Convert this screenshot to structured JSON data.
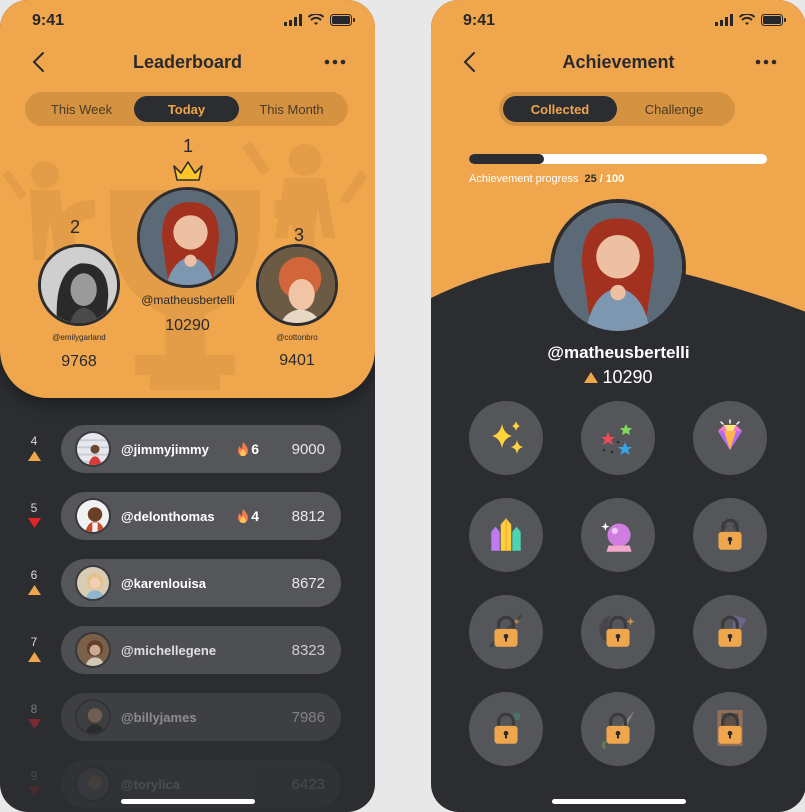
{
  "status": {
    "time": "9:41"
  },
  "leaderboard": {
    "title": "Leaderboard",
    "tabs": [
      {
        "label": "This Week",
        "active": false
      },
      {
        "label": "Today",
        "active": true
      },
      {
        "label": "This Month",
        "active": false
      }
    ],
    "podium": [
      {
        "rank": "1",
        "handle": "@matheusbertelli",
        "score": "10290"
      },
      {
        "rank": "2",
        "handle": "@emilygarland",
        "score": "9768"
      },
      {
        "rank": "3",
        "handle": "@cottonbro",
        "score": "9401"
      }
    ],
    "list": [
      {
        "rank": "4",
        "trend": "up",
        "handle": "@jimmyjimmy",
        "streak": "6",
        "score": "9000"
      },
      {
        "rank": "5",
        "trend": "down",
        "handle": "@delonthomas",
        "streak": "4",
        "score": "8812"
      },
      {
        "rank": "6",
        "trend": "up",
        "handle": "@karenlouisa",
        "streak": "",
        "score": "8672"
      },
      {
        "rank": "7",
        "trend": "up",
        "handle": "@michellegene",
        "streak": "",
        "score": "8323"
      },
      {
        "rank": "8",
        "trend": "down",
        "handle": "@billyjames",
        "streak": "",
        "score": "7986"
      },
      {
        "rank": "9",
        "trend": "down",
        "handle": "@torylica",
        "streak": "",
        "score": "6423"
      }
    ]
  },
  "achievement": {
    "title": "Achievement",
    "tabs": [
      {
        "label": "Collected",
        "active": true
      },
      {
        "label": "Challenge",
        "active": false
      }
    ],
    "progress_label": "Achievement progress",
    "progress_current": "25",
    "progress_sep": " / ",
    "progress_total": "100",
    "progress_fraction": 0.25,
    "handle": "@matheusbertelli",
    "score": "10290",
    "badges": [
      {
        "icon": "sparkles-icon",
        "locked": false
      },
      {
        "icon": "stars-icon",
        "locked": false
      },
      {
        "icon": "diamond-icon",
        "locked": false
      },
      {
        "icon": "crystals-icon",
        "locked": false
      },
      {
        "icon": "crystal-ball-icon",
        "locked": false
      },
      {
        "icon": "locked-badge-icon",
        "locked": true
      },
      {
        "icon": "locked-badge-icon",
        "locked": true
      },
      {
        "icon": "locked-badge-icon",
        "locked": true
      },
      {
        "icon": "locked-badge-icon",
        "locked": true
      },
      {
        "icon": "locked-badge-icon",
        "locked": true
      },
      {
        "icon": "locked-badge-icon",
        "locked": true
      },
      {
        "icon": "locked-badge-icon",
        "locked": true
      }
    ]
  },
  "colors": {
    "accent": "#f0a64c",
    "dark": "#2b2d31",
    "row": "#55565a",
    "up": "#f0a64c",
    "down": "#e0262b"
  }
}
